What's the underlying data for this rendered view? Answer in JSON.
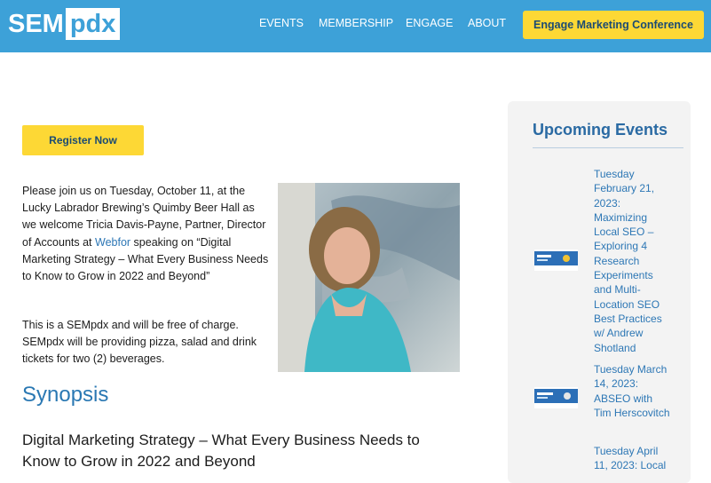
{
  "header": {
    "logo_sem": "SEM",
    "logo_pdx": "pdx",
    "nav": [
      "EVENTS",
      "MEMBERSHIP",
      "ENGAGE",
      "ABOUT"
    ],
    "cta_label": "Engage Marketing Conference",
    "color": "#3da1d8",
    "cta_color": "#fdd835"
  },
  "main": {
    "register_label": "Register Now",
    "intro_before_link": "Please join us on Tuesday, October 11, at the Lucky Labrador Brewing’s Quimby Beer Hall as we welcome Tricia Davis-Payne, Partner, Director of Accounts at ",
    "intro_link": "Webfor",
    "intro_after_link": " speaking on “Digital Marketing Strategy – What Every Business Needs to Know to Grow in 2022 and Beyond”",
    "paragraph2": "This is a SEMpdx and will be free of charge. SEMpdx will be providing pizza, salad and drink tickets for two (2) beverages.",
    "synopsis_heading": "Synopsis",
    "subheading": "Digital Marketing Strategy – What Every Business Needs to Know to Grow in 2022 and Beyond"
  },
  "sidebar": {
    "title": "Upcoming Events",
    "events": [
      {
        "text": "Tuesday February 21, 2023: Maximizing Local SEO – Exploring 4 Research Experiments and Multi-Location SEO Best Practices w/ Andrew Shotland"
      },
      {
        "text": "Tuesday March 14, 2023: ABSEO with Tim Herscovitch"
      },
      {
        "text": "Tuesday April 11, 2023: Local"
      }
    ]
  }
}
